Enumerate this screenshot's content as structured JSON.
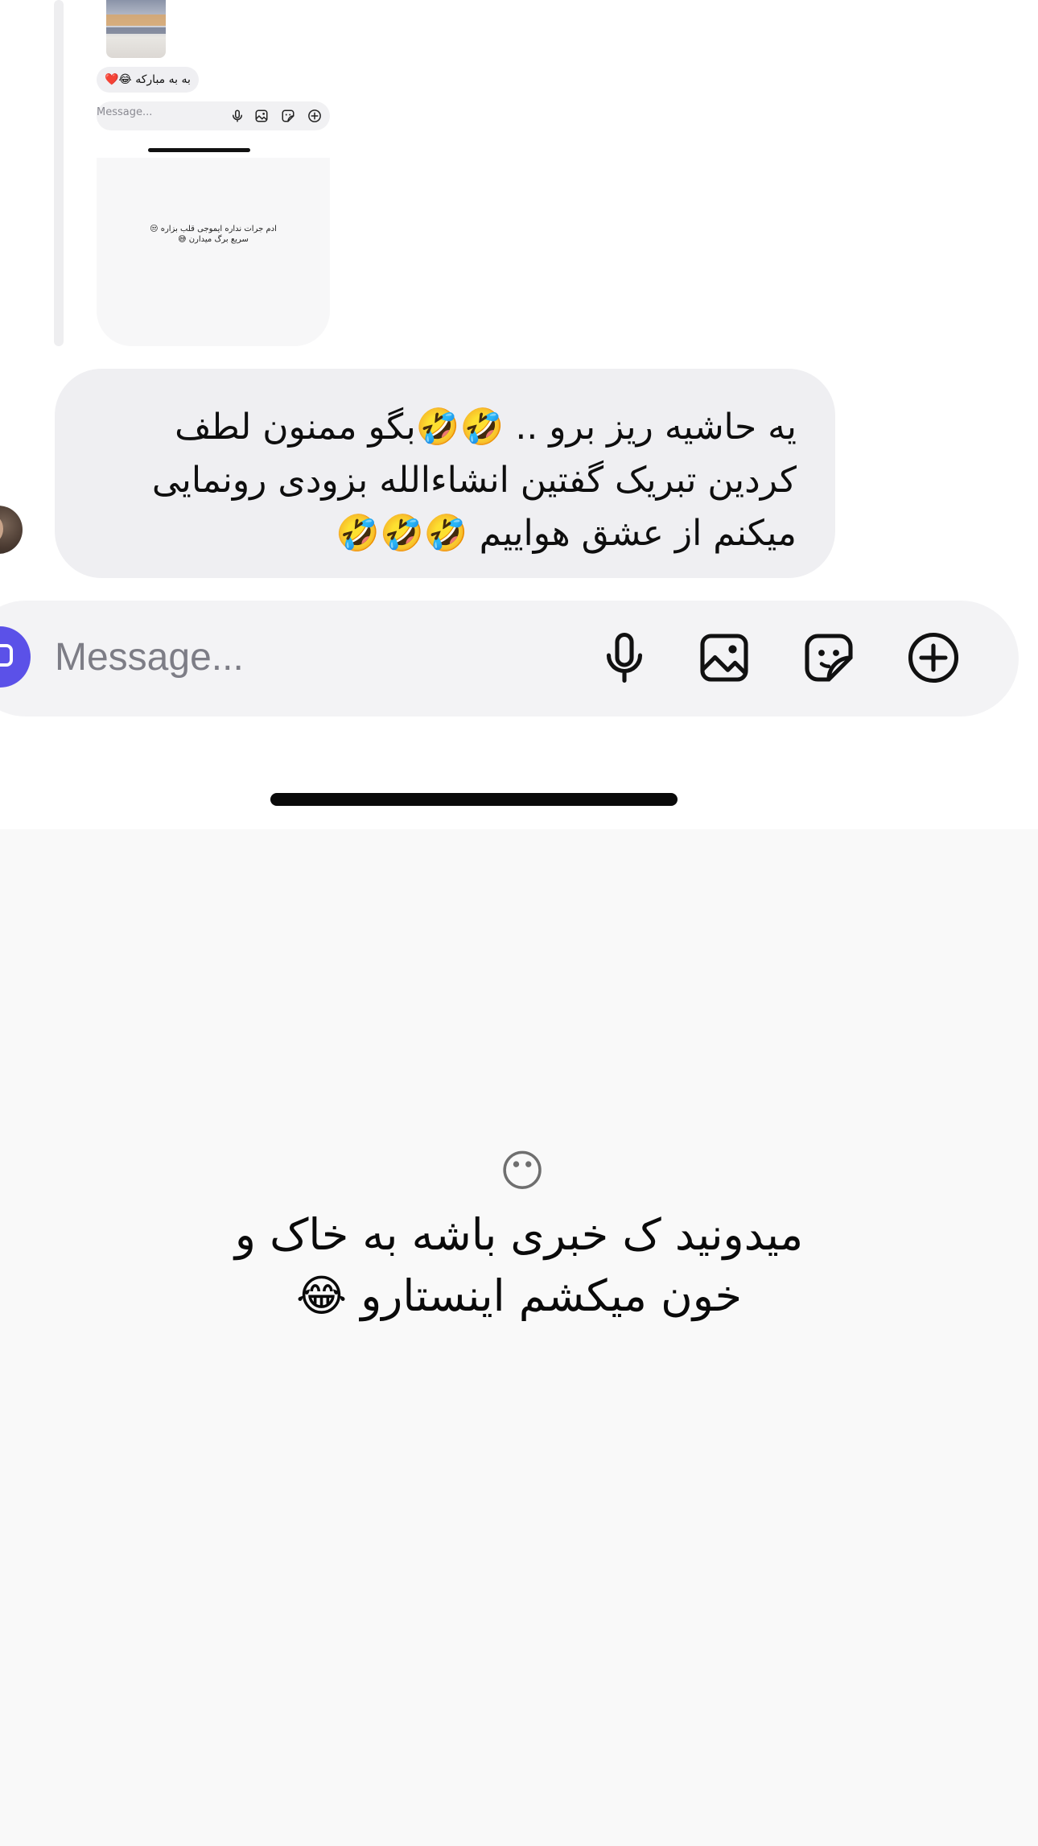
{
  "thread_preview": {
    "reaction_text": "به به مبارکه 😂❤️",
    "composer_placeholder": "Message...",
    "story_text": "ادم جرات نداره ایموجی قلب بزاره 😒\nسریع برگ میدارن 😅"
  },
  "message": {
    "text": "یه حاشیه ریز برو .. 🤣🤣بگو ممنون لطف\nکردین تبریک گفتین  انشاءالله بزودی رونمایی\nمیکنم از عشق هواییم 🤣🤣🤣"
  },
  "composer": {
    "placeholder": "Message...",
    "icons": [
      "microphone-icon",
      "image-icon",
      "sticker-icon",
      "add-icon"
    ]
  },
  "story": {
    "emoji": "😶",
    "caption": "میدونید ک خبری باشه به خاک و\nخون میکشم اینستارو 😂"
  },
  "colors": {
    "camera_button": "#5b51e8",
    "bubble": "#efeff2",
    "composer": "#f3f3f5",
    "story_background": "#f9f9f9"
  }
}
